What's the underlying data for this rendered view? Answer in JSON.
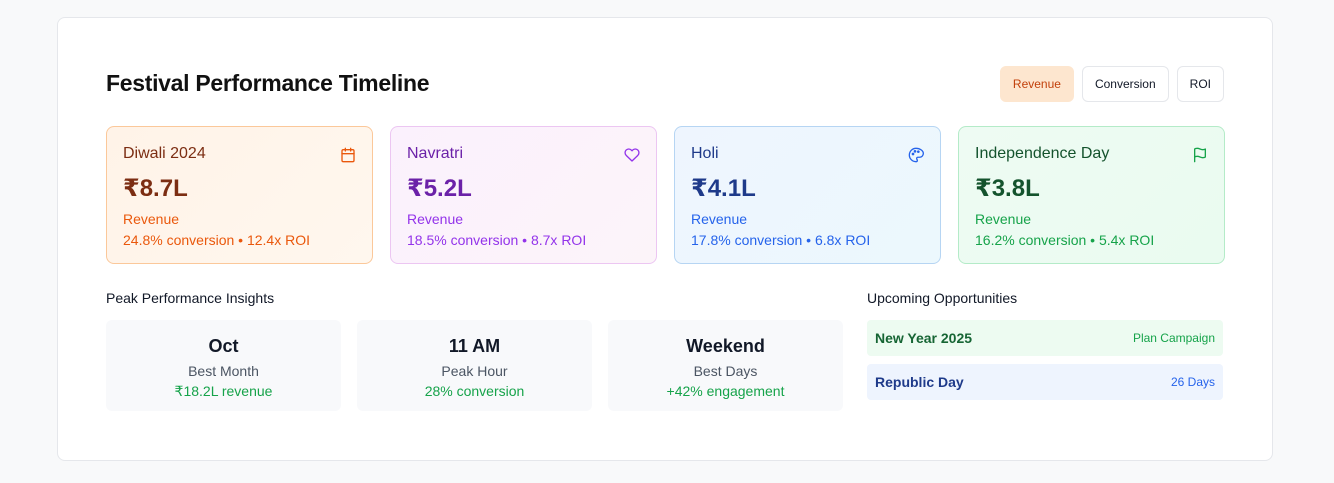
{
  "title": "Festival Performance Timeline",
  "toggles": [
    {
      "label": "Revenue",
      "active": true
    },
    {
      "label": "Conversion",
      "active": false
    },
    {
      "label": "ROI",
      "active": false
    }
  ],
  "festivals": [
    {
      "name": "Diwali 2024",
      "amount": "₹8.7L",
      "metric": "Revenue",
      "detail": "24.8% conversion • 12.4x ROI",
      "icon": "calendar-icon",
      "color": "#ea580c"
    },
    {
      "name": "Navratri",
      "amount": "₹5.2L",
      "metric": "Revenue",
      "detail": "18.5% conversion • 8.7x ROI",
      "icon": "heart-icon",
      "color": "#9333ea"
    },
    {
      "name": "Holi",
      "amount": "₹4.1L",
      "metric": "Revenue",
      "detail": "17.8% conversion • 6.8x ROI",
      "icon": "palette-icon",
      "color": "#2563eb"
    },
    {
      "name": "Independence Day",
      "amount": "₹3.8L",
      "metric": "Revenue",
      "detail": "16.2% conversion • 5.4x ROI",
      "icon": "flag-icon",
      "color": "#16a34a"
    }
  ],
  "insights": {
    "title": "Peak Performance Insights",
    "items": [
      {
        "value": "Oct",
        "label": "Best Month",
        "detail": "₹18.2L revenue"
      },
      {
        "value": "11 AM",
        "label": "Peak Hour",
        "detail": "28% conversion"
      },
      {
        "value": "Weekend",
        "label": "Best Days",
        "detail": "+42% engagement"
      }
    ]
  },
  "opportunities": {
    "title": "Upcoming Opportunities",
    "items": [
      {
        "name": "New Year 2025",
        "action": "Plan Campaign"
      },
      {
        "name": "Republic Day",
        "action": "26 Days"
      }
    ]
  }
}
